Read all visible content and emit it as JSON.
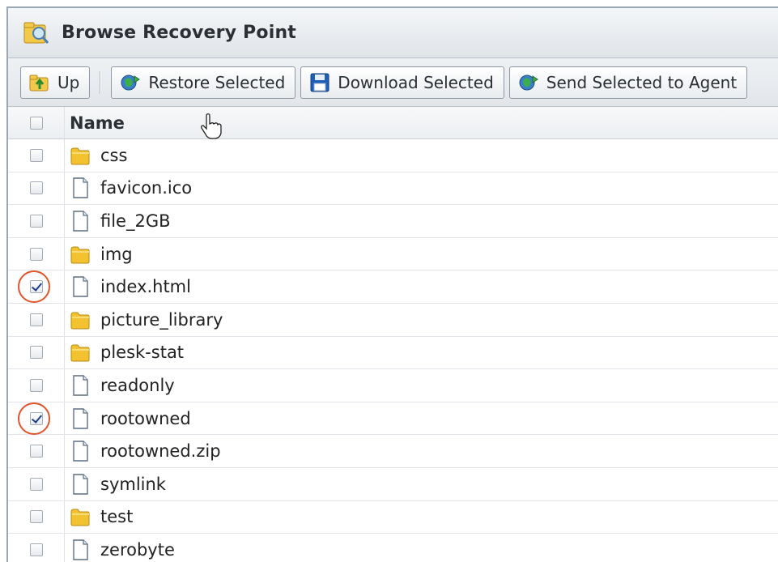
{
  "window": {
    "title": "Browse Recovery Point"
  },
  "toolbar": {
    "up_label": "Up",
    "restore_label": "Restore Selected",
    "download_label": "Download Selected",
    "send_label": "Send Selected to Agent"
  },
  "table": {
    "column_name": "Name",
    "rows": [
      {
        "name": "css",
        "type": "folder",
        "checked": false
      },
      {
        "name": "favicon.ico",
        "type": "file",
        "checked": false
      },
      {
        "name": "file_2GB",
        "type": "file",
        "checked": false
      },
      {
        "name": "img",
        "type": "folder",
        "checked": false
      },
      {
        "name": "index.html",
        "type": "file",
        "checked": true
      },
      {
        "name": "picture_library",
        "type": "folder",
        "checked": false
      },
      {
        "name": "plesk-stat",
        "type": "folder",
        "checked": false
      },
      {
        "name": "readonly",
        "type": "file",
        "checked": false
      },
      {
        "name": "rootowned",
        "type": "file",
        "checked": true
      },
      {
        "name": "rootowned.zip",
        "type": "file",
        "checked": false
      },
      {
        "name": "symlink",
        "type": "file",
        "checked": false
      },
      {
        "name": "test",
        "type": "folder",
        "checked": false
      },
      {
        "name": "zerobyte",
        "type": "file",
        "checked": false
      }
    ]
  },
  "colors": {
    "highlight_ring": "#e2542a",
    "folder": "#f2c230"
  }
}
